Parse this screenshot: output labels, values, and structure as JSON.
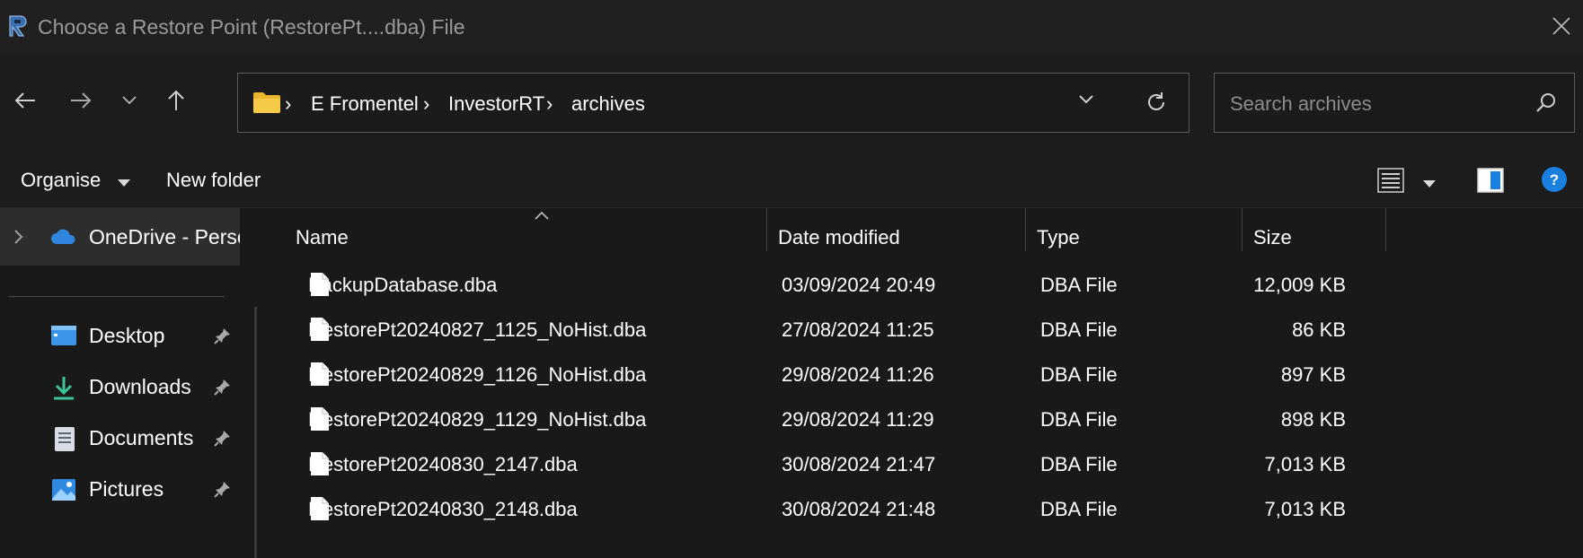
{
  "window": {
    "title": "Choose a Restore Point (RestorePt....dba) File",
    "app_icon": "investorrt-app-icon",
    "close_icon": "close-icon"
  },
  "nav": {
    "back_icon": "back-arrow-icon",
    "forward_icon": "forward-arrow-icon",
    "recent_icon": "chevron-down-icon",
    "up_icon": "up-arrow-icon"
  },
  "address": {
    "folder_icon": "folder-icon",
    "crumbs": [
      "E Fromentel",
      "InvestorRT",
      "archives"
    ],
    "separator": "›",
    "dropdown_icon": "chevron-down-icon",
    "refresh_icon": "refresh-icon"
  },
  "search": {
    "placeholder": "Search archives",
    "value": "",
    "icon": "search-icon"
  },
  "commands": {
    "organise": "Organise",
    "new_folder": "New folder",
    "view_icon": "list-view-icon",
    "preview_icon": "preview-pane-icon",
    "help_icon": "help-icon"
  },
  "sidebar": {
    "onedrive": "OneDrive - Perso",
    "items": [
      {
        "label": "Desktop",
        "icon": "desktop-icon",
        "pinned": true
      },
      {
        "label": "Downloads",
        "icon": "downloads-icon",
        "pinned": true
      },
      {
        "label": "Documents",
        "icon": "documents-icon",
        "pinned": true
      },
      {
        "label": "Pictures",
        "icon": "pictures-icon",
        "pinned": true
      }
    ]
  },
  "columns": {
    "name": "Name",
    "date": "Date modified",
    "type": "Type",
    "size": "Size"
  },
  "files": [
    {
      "name": "BackupDatabase.dba",
      "date": "03/09/2024 20:49",
      "type": "DBA File",
      "size": "12,009 KB"
    },
    {
      "name": "RestorePt20240827_1125_NoHist.dba",
      "date": "27/08/2024 11:25",
      "type": "DBA File",
      "size": "86 KB"
    },
    {
      "name": "RestorePt20240829_1126_NoHist.dba",
      "date": "29/08/2024 11:26",
      "type": "DBA File",
      "size": "897 KB"
    },
    {
      "name": "RestorePt20240829_1129_NoHist.dba",
      "date": "29/08/2024 11:29",
      "type": "DBA File",
      "size": "898 KB"
    },
    {
      "name": "RestorePt20240830_2147.dba",
      "date": "30/08/2024 21:47",
      "type": "DBA File",
      "size": "7,013 KB"
    },
    {
      "name": "RestorePt20240830_2148.dba",
      "date": "30/08/2024 21:48",
      "type": "DBA File",
      "size": "7,013 KB"
    }
  ],
  "colors": {
    "background": "#191919",
    "titlebar": "#202020",
    "text": "#ffffff",
    "muted_text": "#9a9a9a",
    "folder_yellow": "#f0c23a",
    "onedrive_blue": "#3a8ee6",
    "help_blue": "#1a80e0"
  }
}
